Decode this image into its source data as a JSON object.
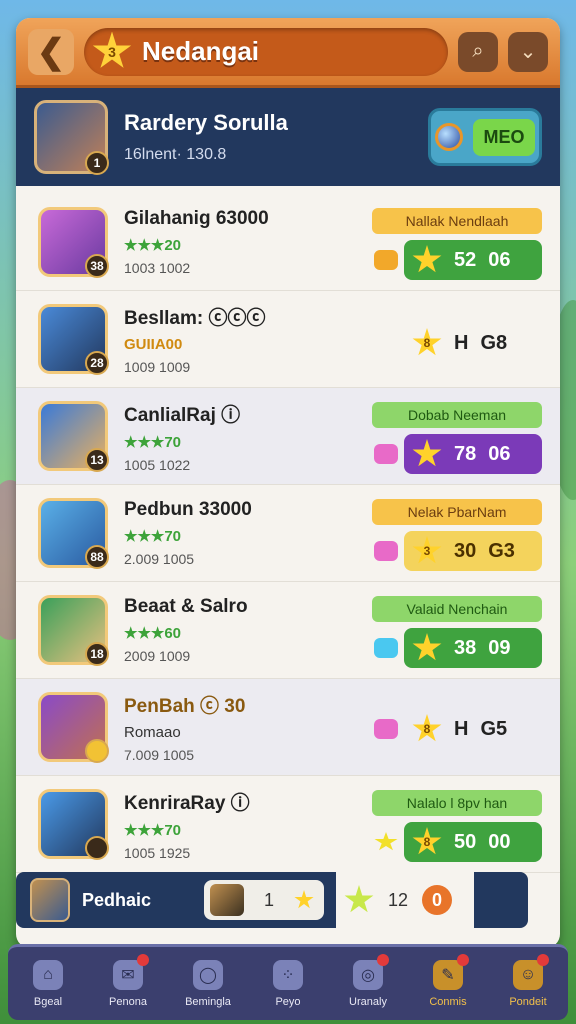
{
  "header": {
    "title": "Nedangai",
    "title_badge": "3",
    "back_icon": "arrow-left-icon",
    "search_icon": "search-icon",
    "menu_icon": "chevron-down-icon"
  },
  "hero": {
    "name": "Rardery Sorulla",
    "stats": "16lnent·  130.8",
    "level": "1",
    "badge_label": "MEO"
  },
  "rows": [
    {
      "name": "Gilahanig 63000",
      "sub": "★★★20",
      "nums": "1003  1002",
      "level": "38",
      "tag": "Nallak Nendlaah",
      "score_a": "52",
      "score_b": "06",
      "star_label": ""
    },
    {
      "name": "Besllam: ⓒⓒⓒ",
      "sub": "GUIIA00",
      "nums": "1009  1009",
      "level": "28",
      "tag": "",
      "score_a": "H",
      "score_b": "G8",
      "star_label": "8"
    },
    {
      "name": "CanlialRaj ⓘ",
      "sub": "★★★70",
      "nums": "1005  1022",
      "level": "13",
      "tag": "Dobab Neeman",
      "score_a": "78",
      "score_b": "06",
      "star_label": ""
    },
    {
      "name": "Pedbun 33000",
      "sub": "★★★70",
      "nums": "2.009  1005",
      "level": "88",
      "tag": "Nelak PbarNam",
      "score_a": "30",
      "score_b": "G3",
      "star_label": "3"
    },
    {
      "name": "Beaat & Salro",
      "sub": "★★★60",
      "nums": "2009  1009",
      "level": "18",
      "tag": "Valaid Nenchain",
      "score_a": "38",
      "score_b": "09",
      "star_label": ""
    },
    {
      "name": "PenBah ⓒ 30",
      "sub": "Romaao",
      "nums": "7.009  1005",
      "level": "",
      "tag": "",
      "score_a": "H",
      "score_b": "G5",
      "star_label": "8"
    },
    {
      "name": "KenriraRay ⓘ",
      "sub": "★★★70",
      "nums": "1005  1925",
      "level": "",
      "tag": "Nalalo l 8pv han",
      "score_a": "50",
      "score_b": "00",
      "star_label": "8"
    }
  ],
  "footer_player": {
    "name": "Pedhaic",
    "rank": "1",
    "score": "12",
    "badge": "0"
  },
  "nav": [
    {
      "label": "Bgeal",
      "icon": "home-icon"
    },
    {
      "label": "Penona",
      "icon": "mail-icon"
    },
    {
      "label": "Bemingla",
      "icon": "search-icon"
    },
    {
      "label": "Peyo",
      "icon": "gamepad-icon"
    },
    {
      "label": "Uranaly",
      "icon": "target-icon"
    },
    {
      "label": "Conmis",
      "icon": "chat-icon"
    },
    {
      "label": "Pondeit",
      "icon": "profile-icon"
    }
  ],
  "colors": {
    "accent": "#d9792e",
    "panel": "#22385e",
    "nav": "#3b3f6e"
  }
}
